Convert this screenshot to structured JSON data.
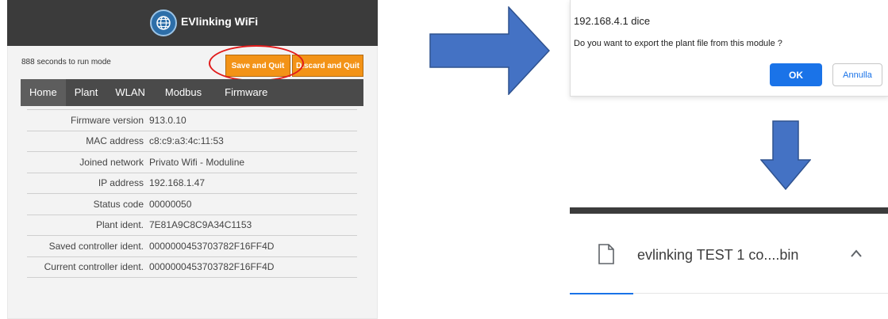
{
  "app": {
    "title": "EVlinking WiFi",
    "countdown": "888 seconds to run mode",
    "buttons": {
      "save": "Save and Quit",
      "discard": "Discard and Quit"
    },
    "tabs": [
      {
        "label": "Home",
        "active": true
      },
      {
        "label": "Plant",
        "active": false
      },
      {
        "label": "WLAN",
        "active": false
      },
      {
        "label": "Modbus",
        "active": false
      },
      {
        "label": "Firmware",
        "active": false
      }
    ],
    "info": [
      {
        "key": "Firmware version",
        "value": "913.0.10"
      },
      {
        "key": "MAC address",
        "value": "c8:c9:a3:4c:11:53"
      },
      {
        "key": "Joined network",
        "value": "Privato Wifi - Moduline"
      },
      {
        "key": "IP address",
        "value": "192.168.1.47"
      },
      {
        "key": "Status code",
        "value": "00000050"
      },
      {
        "key": "Plant ident.",
        "value": "7E81A9C8C9A34C1153"
      },
      {
        "key": "Saved controller ident.",
        "value": "0000000453703782F16FF4D"
      },
      {
        "key": "Current controller ident.",
        "value": "0000000453703782F16FF4D"
      }
    ]
  },
  "dialog": {
    "host": "192.168.4.1 dice",
    "message": "Do you want to export the plant file from this module ?",
    "ok": "OK",
    "cancel": "Annulla"
  },
  "download": {
    "filename": "evlinking TEST 1 co....bin",
    "progress_fraction": 0.2
  },
  "colors": {
    "header": "#3b3b3b",
    "nav": "#4a4a4a",
    "accent_orange": "#f39317",
    "highlight_red": "#e11b1b",
    "arrow_blue": "#4472c4",
    "dialog_blue": "#1a73e8"
  },
  "icons": [
    "globe-wifi-icon",
    "arrow-right-icon",
    "arrow-down-icon",
    "file-icon",
    "chevron-up-icon"
  ]
}
